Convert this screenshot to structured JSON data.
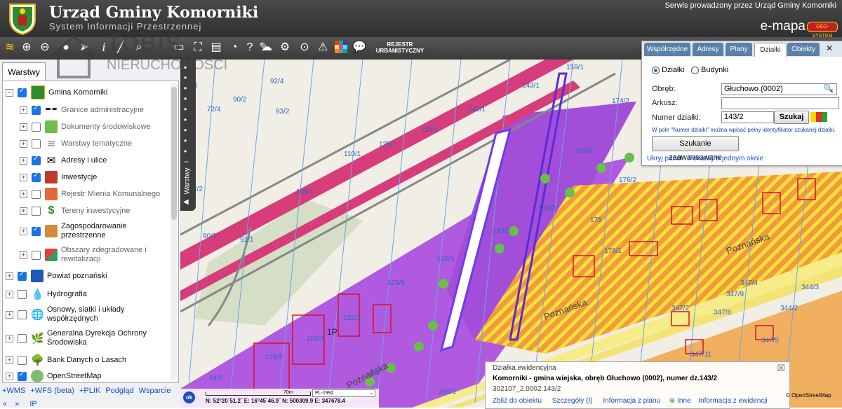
{
  "header": {
    "title": "Urząd Gminy Komorniki",
    "subtitle": "System Informacji Przestrzennej",
    "service_note": "Serwis prowadzony przez Urząd Gminy Komorniki",
    "emapa": "e-mapa",
    "badge": "GEO-SYSTEM"
  },
  "toolbar": {
    "rejestr": "REJESTR URBANISTYCZNY",
    "icons": [
      "layers-icon",
      "zoom-in-icon",
      "zoom-out-icon",
      "full-extent-icon",
      "select-icon",
      "info-icon",
      "measure-icon",
      "search-icon",
      "print-icon",
      "fit-icon",
      "comment-icon",
      "help-icon",
      "share-icon",
      "link-icon",
      "cloud-icon",
      "settings-icon",
      "magnifier-icon",
      "warning-icon",
      "colors-icon",
      "chat-icon"
    ]
  },
  "watermark": {
    "logo": "TOBIS",
    "sub": "NIERUCHOMOŚCI"
  },
  "layers_panel": {
    "tab": "Warstwy",
    "items": [
      {
        "label": "Gmina Komorniki",
        "checked": true,
        "level": 0,
        "expand": "-"
      },
      {
        "label": "Granice administracyjne",
        "checked": true,
        "level": 1,
        "expand": "+"
      },
      {
        "label": "Dokumenty środowiskowe",
        "checked": false,
        "level": 1,
        "expand": "+"
      },
      {
        "label": "Warstwy tematyczne",
        "checked": false,
        "level": 1,
        "expand": "+"
      },
      {
        "label": "Adresy i ulice",
        "checked": true,
        "level": 1,
        "expand": "+"
      },
      {
        "label": "Inwestycje",
        "checked": true,
        "level": 1,
        "expand": "+"
      },
      {
        "label": "Rejestr Mienia Komunalnego",
        "checked": false,
        "level": 1,
        "expand": "+"
      },
      {
        "label": "Tereny inwestycyjne",
        "checked": false,
        "level": 1,
        "expand": "+"
      },
      {
        "label": "Zagospodarowanie przestrzenne",
        "checked": true,
        "level": 1,
        "expand": "+"
      },
      {
        "label": "Obszary zdegradowane i rewitalizacji",
        "checked": false,
        "level": 1,
        "expand": "+"
      },
      {
        "label": "Powiat poznański",
        "checked": true,
        "level": 0,
        "expand": "+"
      },
      {
        "label": "Hydrografia",
        "checked": false,
        "level": 0,
        "expand": "+"
      },
      {
        "label": "Osnowy, siatki i układy współrzędnych",
        "checked": false,
        "level": 0,
        "expand": "+"
      },
      {
        "label": "Generalna Dyrekcja Ochrony Środowiska",
        "checked": false,
        "level": 0,
        "expand": "+"
      },
      {
        "label": "Bank Danych o Lasach",
        "checked": false,
        "level": 0,
        "expand": "+"
      },
      {
        "label": "OpenStreetMap",
        "checked": true,
        "level": 0,
        "expand": "+"
      }
    ],
    "bottom_links": [
      "+WMS",
      "+WFS (beta)",
      "+PLIK",
      "Podgląd",
      "Wsparcie"
    ],
    "nav": [
      "«",
      "»",
      "IP"
    ]
  },
  "sidebar_label": "Warstwy",
  "search_panel": {
    "tabs": [
      "Współrzędne",
      "Adresy",
      "Plany",
      "Działki",
      "Obiekty"
    ],
    "active_tab": "Działki",
    "radio_dzialki": "Działki",
    "radio_budynki": "Budynki",
    "obreb_label": "Obręb:",
    "obreb_value": "Głuchowo (0002)",
    "arkusz_label": "Arkusz:",
    "arkusz_value": "",
    "numer_label": "Numer działki:",
    "numer_value": "143/2",
    "search_btn": "Szukaj",
    "hint": "W pole \"Numer działki\" można wpisać pełny identyfikator szukanej działki.",
    "advanced_btn": "Szukanie zaawansowane",
    "hide_link": "Ukryj panel",
    "window_link": "Pokazuj w jednym oknie"
  },
  "popup": {
    "title": "Działka ewidencyjna",
    "name": "Komorniki - gmina wiejska, obręb Głuchowo (0002), numer dz.143/2",
    "id": "302107_2.0002.143/2",
    "links": [
      "Zbliż do obiektu",
      "Szczegóły (I)",
      "Informacja z planu",
      "Inne",
      "Informacja z ewidencji"
    ]
  },
  "coords": {
    "ok": "ok",
    "scale": "70m",
    "crs": "PL-1992",
    "text": "N: 52°20´51.2˝  E: 16°45´46.9˝  N: 500309.9  E: 347678.4"
  },
  "attribution": "© OpenStreetMap",
  "map_labels": [
    "72/4",
    "92/4",
    "90/2",
    "93/2",
    "143/1",
    "142/1",
    "126/1",
    "125/1",
    "110/1",
    "109/1",
    "91/1",
    "90/1",
    "159/1",
    "174/2",
    "160/2",
    "159/2",
    "175",
    "176/2",
    "176/1",
    "143/2",
    "142/3",
    "126/5",
    "125/3",
    "110/3",
    "109/3",
    "91/2",
    "356/1",
    "344/3",
    "347/8",
    "344/2",
    "347/2",
    "347/4",
    "347/9",
    "347/5",
    "344/3",
    "347/11",
    "1P",
    "ZL",
    "Poznańska",
    "Poznańska",
    "18MN",
    "3/S",
    "1/4",
    "92/1",
    "15",
    "16",
    "17"
  ]
}
